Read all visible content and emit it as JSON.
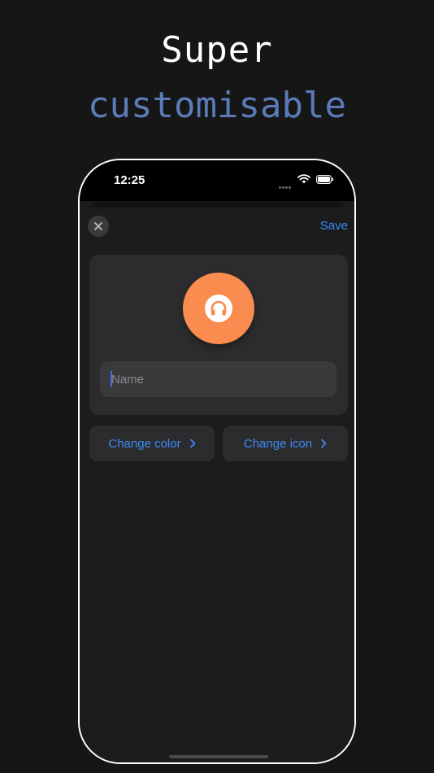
{
  "headline": {
    "line1": "Super",
    "line2": "customisable"
  },
  "status_bar": {
    "time": "12:25"
  },
  "sheet": {
    "save_label": "Save",
    "name_field": {
      "placeholder": "Name",
      "value": ""
    },
    "icon": {
      "name": "headphones-icon",
      "color": "#fa8c4f"
    },
    "buttons": [
      {
        "label": "Change color"
      },
      {
        "label": "Change icon"
      }
    ]
  },
  "colors": {
    "accent": "#3a8bf5",
    "headline_accent": "#5b7ab8",
    "background": "#161616"
  }
}
